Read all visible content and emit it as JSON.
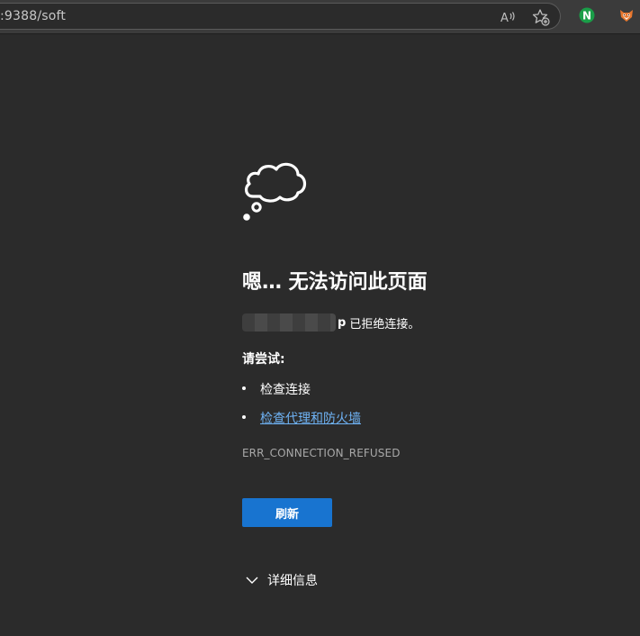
{
  "browser": {
    "url_visible": ":9388/soft",
    "read_aloud_icon": "read-aloud-icon",
    "favorite_icon": "add-favorite-icon",
    "extension_1": {
      "icon": "n-extension-icon",
      "letter": "N",
      "color": "#1a9e48"
    },
    "extension_2": {
      "icon": "fox-extension-icon"
    }
  },
  "error_page": {
    "illustration": "cloud-thought-icon",
    "headline": "嗯… 无法访问此页面",
    "host_tail": "p",
    "refused_message": "已拒绝连接。",
    "try_label": "请尝试:",
    "suggestions": [
      {
        "text": "检查连接",
        "is_link": false
      },
      {
        "text": "检查代理和防火墙",
        "is_link": true
      }
    ],
    "error_code": "ERR_CONNECTION_REFUSED",
    "refresh_label": "刷新",
    "details_label": "详细信息"
  },
  "colors": {
    "background": "#2b2b2b",
    "primary_button": "#1874d0",
    "link": "#6fb3f5"
  }
}
